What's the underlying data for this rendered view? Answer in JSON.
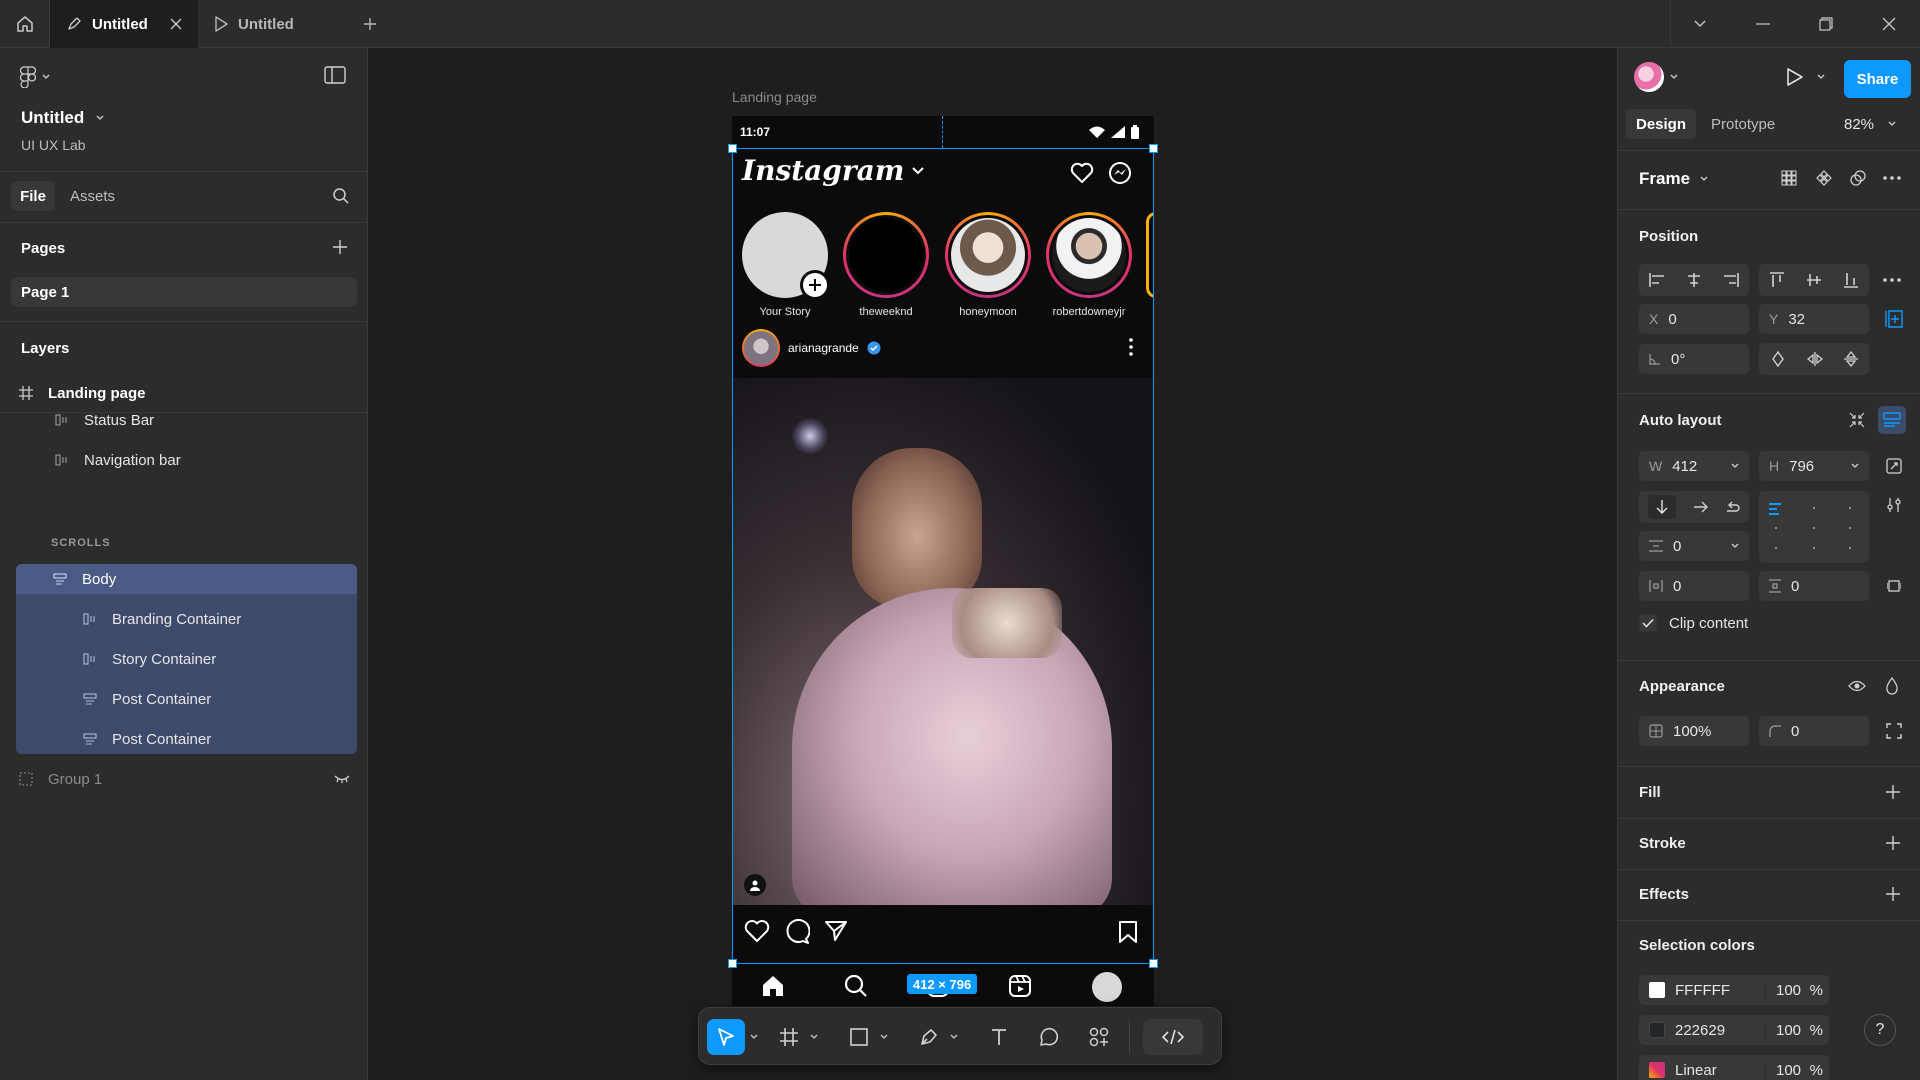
{
  "titlebar": {
    "tabs": [
      {
        "label": "Untitled",
        "active": true
      },
      {
        "label": "Untitled",
        "active": false
      }
    ]
  },
  "left_panel": {
    "file_name": "Untitled",
    "team_name": "UI UX Lab",
    "tabs": [
      "File",
      "Assets"
    ],
    "pages_title": "Pages",
    "pages": [
      "Page 1"
    ],
    "layers_title": "Layers",
    "layers": {
      "root": "Landing page",
      "status_bar": "Status Bar",
      "navigation_bar": "Navigation bar",
      "scrolls_label": "SCROLLS",
      "body": "Body",
      "children": [
        "Branding Container",
        "Story Container",
        "Post Container",
        "Post Container"
      ],
      "group": "Group 1"
    }
  },
  "canvas": {
    "frame_label": "Landing page",
    "size_badge": "412 × 796",
    "phone": {
      "time": "11:07",
      "brand": "Instagram",
      "stories": [
        {
          "name": "Your Story"
        },
        {
          "name": "theweeknd"
        },
        {
          "name": "honeymoon"
        },
        {
          "name": "robertdowneyjr"
        }
      ],
      "post_user": "arianagrande"
    }
  },
  "toolbar": {
    "tools": [
      "move-tool",
      "frame-tool",
      "shape-tool",
      "pen-tool",
      "text-tool",
      "comment-tool",
      "actions-tool",
      "dev-mode-toggle"
    ]
  },
  "right_panel": {
    "share_label": "Share",
    "tabs": [
      "Design",
      "Prototype"
    ],
    "zoom": "82%",
    "frame_label": "Frame",
    "position": {
      "title": "Position",
      "x_label": "X",
      "x": "0",
      "y_label": "Y",
      "y": "32",
      "rotation": "0°"
    },
    "auto_layout": {
      "title": "Auto layout",
      "w_label": "W",
      "w": "412",
      "h_label": "H",
      "h": "796",
      "gap": "0",
      "padding_h": "0",
      "padding_v": "0",
      "clip_content": "Clip content"
    },
    "appearance": {
      "title": "Appearance",
      "opacity": "100%",
      "radius": "0"
    },
    "fill_title": "Fill",
    "stroke_title": "Stroke",
    "effects_title": "Effects",
    "selection_colors": {
      "title": "Selection colors",
      "items": [
        {
          "hex": "FFFFFF",
          "opacity": "100",
          "unit": "%",
          "swatch": "#ffffff"
        },
        {
          "hex": "222629",
          "opacity": "100",
          "unit": "%",
          "swatch": "#222629"
        },
        {
          "hex": "Linear",
          "opacity": "100",
          "unit": "%",
          "swatch": "linear"
        }
      ]
    },
    "help": "?"
  },
  "colors": {
    "accent": "#0d99ff",
    "selection": "#3d4a6b",
    "canvas_bg": "#1e1e1e",
    "panel_bg": "#2c2c2c"
  }
}
